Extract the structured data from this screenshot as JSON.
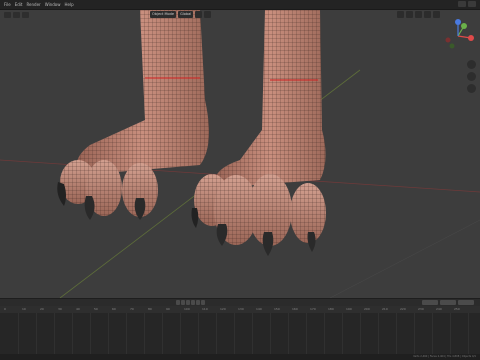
{
  "top_menu": [
    "File",
    "Edit",
    "Render",
    "Window",
    "Help"
  ],
  "viewport": {
    "mode": "Object Mode",
    "view": "Global",
    "gizmo": {
      "x": "X",
      "y": "Y",
      "z": "Z"
    }
  },
  "timeline": {
    "ruler": [
      "0",
      "10",
      "20",
      "30",
      "40",
      "50",
      "60",
      "70",
      "80",
      "90",
      "100",
      "110",
      "120",
      "130",
      "140",
      "150",
      "160",
      "170",
      "180",
      "190",
      "200",
      "210",
      "220",
      "230",
      "240",
      "250"
    ]
  },
  "statusbar": "Verts 2,460 | Faces 2,404 | Tris 4,808 | Objects 0/1"
}
